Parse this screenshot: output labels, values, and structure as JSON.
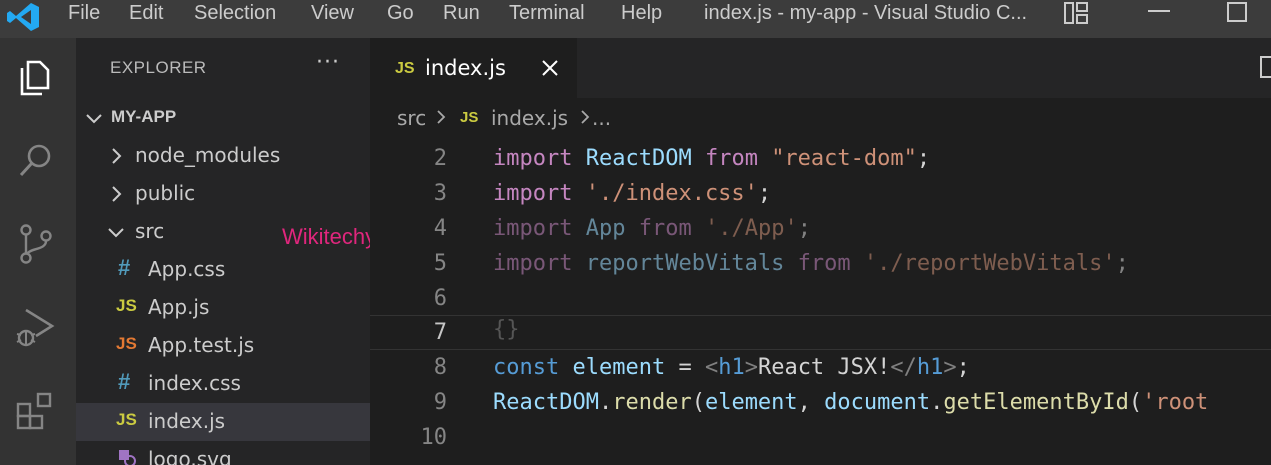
{
  "titlebar": {
    "menu": [
      "File",
      "Edit",
      "Selection",
      "View",
      "Go",
      "Run",
      "Terminal",
      "Help"
    ],
    "window_title": "index.js - my-app - Visual Studio C..."
  },
  "activity_bar": {
    "icons": [
      "files-icon",
      "search-icon",
      "source-control-icon",
      "run-debug-icon",
      "extensions-icon"
    ]
  },
  "sidebar": {
    "title": "EXPLORER",
    "more_label": "···",
    "root": "MY-APP",
    "items": [
      {
        "label": "node_modules",
        "type": "folder",
        "expanded": false
      },
      {
        "label": "public",
        "type": "folder",
        "expanded": false
      },
      {
        "label": "src",
        "type": "folder",
        "expanded": true
      },
      {
        "label": "App.css",
        "type": "css",
        "icon_text": "#"
      },
      {
        "label": "App.js",
        "type": "js",
        "icon_text": "JS"
      },
      {
        "label": "App.test.js",
        "type": "test",
        "icon_text": "JS"
      },
      {
        "label": "index.css",
        "type": "css",
        "icon_text": "#"
      },
      {
        "label": "index.js",
        "type": "js",
        "icon_text": "JS",
        "active": true
      },
      {
        "label": "logo.svg",
        "type": "svg"
      }
    ],
    "watermark": "Wikitechy"
  },
  "tab": {
    "icon_text": "JS",
    "label": "index.js"
  },
  "breadcrumb": {
    "folder": "src",
    "icon_text": "JS",
    "file": "index.js",
    "ellipsis": "..."
  },
  "editor": {
    "top_partial": "                   ",
    "lines": [
      {
        "n": "2"
      },
      {
        "n": "3"
      },
      {
        "n": "4"
      },
      {
        "n": "5"
      },
      {
        "n": "6"
      },
      {
        "n": "7",
        "current": true
      },
      {
        "n": "8"
      },
      {
        "n": "9"
      },
      {
        "n": "10"
      }
    ],
    "ghost_brace": "{}",
    "tokens": {
      "l2": [
        "import",
        " ",
        "ReactDOM",
        " ",
        "from",
        " ",
        "\"react-dom\"",
        ";"
      ],
      "l3": [
        "import",
        " ",
        "'./index.css'",
        ";"
      ],
      "l4": [
        "import",
        " ",
        "App",
        " ",
        "from",
        " ",
        "'./App'",
        ";"
      ],
      "l5": [
        "import",
        " ",
        "reportWebVitals",
        " ",
        "from",
        " ",
        "'./reportWebVitals'",
        ";"
      ],
      "l8": [
        "const",
        " ",
        "element",
        " = ",
        "<",
        "h1",
        ">",
        "React JSX!",
        "</",
        "h1",
        ">",
        ";"
      ],
      "l9": [
        "ReactDOM",
        ".",
        "render",
        "(",
        "element",
        ", ",
        "document",
        ".",
        "getElementById",
        "(",
        "'root"
      ]
    }
  },
  "colors": {
    "accent": "#007acc",
    "watermark": "#e0267d",
    "js_icon": "#cbcb41",
    "css_icon": "#519aba"
  }
}
